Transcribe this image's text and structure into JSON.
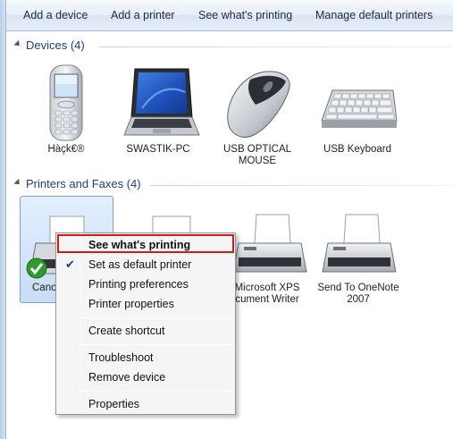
{
  "toolbar": {
    "add_device": "Add a device",
    "add_printer": "Add a printer",
    "see_printing": "See what's printing",
    "manage_default": "Manage default printers"
  },
  "groups": {
    "devices": {
      "title": "Devices (4)"
    },
    "printers": {
      "title": "Printers and Faxes (4)"
    }
  },
  "devices": [
    {
      "label": "Hàçk€®",
      "icon": "mobile-phone-icon"
    },
    {
      "label": "SWASTIK-PC",
      "icon": "laptop-icon"
    },
    {
      "label": "USB OPTICAL MOUSE",
      "icon": "mouse-icon"
    },
    {
      "label": "USB Keyboard",
      "icon": "keyboard-icon"
    }
  ],
  "printers": [
    {
      "label": "Canon",
      "icon": "printer-icon",
      "default": true
    },
    {
      "label": "",
      "icon": "printer-icon"
    },
    {
      "label": "Microsoft XPS Document Writer",
      "visible_label": "Microsoft XPS\ncument Writer",
      "icon": "printer-icon"
    },
    {
      "label": "Send To OneNote 2007",
      "icon": "printer-icon"
    }
  ],
  "context_menu": {
    "items": [
      {
        "label": "See what's printing",
        "bold": true,
        "highlighted": true
      },
      {
        "label": "Set as default printer",
        "checked": true
      },
      {
        "label": "Printing preferences"
      },
      {
        "label": "Printer properties"
      },
      {
        "label": "Create shortcut"
      },
      {
        "label": "Troubleshoot"
      },
      {
        "label": "Remove device"
      },
      {
        "label": "Properties"
      }
    ]
  },
  "colors": {
    "group_title": "#1e3b8a",
    "highlight_border": "#d21c1c",
    "check_mark": "#1c3f94"
  }
}
